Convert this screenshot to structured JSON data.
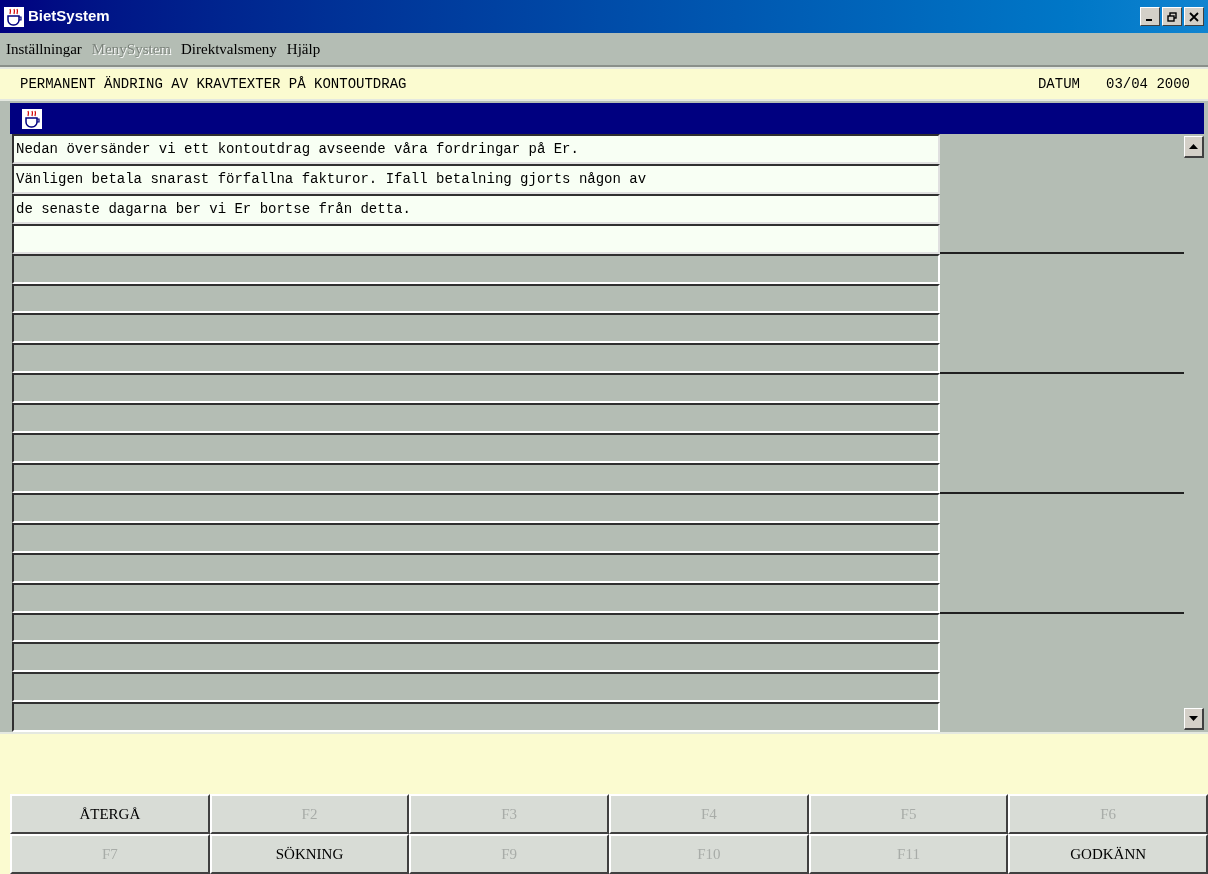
{
  "window": {
    "title": "BietSystem"
  },
  "menu": [
    {
      "label": "Inställningar",
      "disabled": false
    },
    {
      "label": "MenySystem",
      "disabled": true
    },
    {
      "label": "Direktvalsmeny",
      "disabled": false
    },
    {
      "label": "Hjälp",
      "disabled": false
    }
  ],
  "header": {
    "title": "PERMANENT ÄNDRING AV KRAVTEXTER PÅ KONTOUTDRAG",
    "date_label": "DATUM",
    "date": "03/04 2000"
  },
  "lines": [
    {
      "value": "Nedan översänder vi ett kontoutdrag avseende våra fordringar på Er.",
      "disabled": false
    },
    {
      "value": "Vänligen betala snarast förfallna fakturor. Ifall betalning gjorts någon av",
      "disabled": false
    },
    {
      "value": "de senaste dagarna ber vi Er bortse från detta.",
      "disabled": false
    },
    {
      "disabled": false
    },
    {
      "disabled": true
    },
    {
      "disabled": true
    },
    {
      "disabled": true
    },
    {
      "disabled": true
    },
    {
      "disabled": true
    },
    {
      "disabled": true
    },
    {
      "disabled": true
    },
    {
      "disabled": true
    },
    {
      "disabled": true
    },
    {
      "disabled": true
    },
    {
      "disabled": true
    },
    {
      "disabled": true
    },
    {
      "disabled": true
    },
    {
      "disabled": true
    },
    {
      "disabled": true
    },
    {
      "disabled": true
    }
  ],
  "buttons": [
    {
      "label": "ÅTERGÅ",
      "disabled": false
    },
    {
      "label": "F2",
      "disabled": true
    },
    {
      "label": "F3",
      "disabled": true
    },
    {
      "label": "F4",
      "disabled": true
    },
    {
      "label": "F5",
      "disabled": true
    },
    {
      "label": "F6",
      "disabled": true
    },
    {
      "label": "F7",
      "disabled": true
    },
    {
      "label": "SÖKNING",
      "disabled": false
    },
    {
      "label": "F9",
      "disabled": true
    },
    {
      "label": "F10",
      "disabled": true
    },
    {
      "label": "F11",
      "disabled": true
    },
    {
      "label": "GODKÄNN",
      "disabled": false
    }
  ]
}
